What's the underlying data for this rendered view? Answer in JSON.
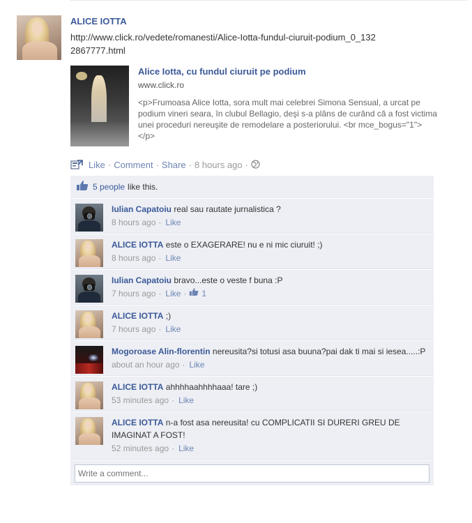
{
  "post": {
    "author": "ALICE IOTTA",
    "link_url": "http://www.click.ro/vedete/romanesti/Alice-Iotta-fundul-ciuruit-podium_0_1322867777.html",
    "attachment": {
      "title": "Alice Iotta, cu fundul ciuruit pe podium",
      "domain": "www.click.ro",
      "description": "<p>Frumoasa Alice Iotta, sora mult mai celebrei Simona Sensual, a urcat pe podium vineri seara, în clubul Bellagio, deşi s-a plâns de curând că a fost victima unei proceduri nereuşite de remodelare a posteriorului. <br mce_bogus=\"1\"></p>"
    },
    "actions": {
      "like": "Like",
      "comment": "Comment",
      "share": "Share",
      "time": "8 hours ago"
    }
  },
  "likes": {
    "people": "5 people",
    "suffix": "like this."
  },
  "comments": [
    {
      "author": "Iulian Capatoiu",
      "text": "real sau rautate jurnalistica ?",
      "time": "8 hours ago",
      "like": "Like",
      "avatar": "camera-man"
    },
    {
      "author": "ALICE IOTTA",
      "text": "este o EXAGERARE! nu e ni mic ciuruit! ;)",
      "time": "8 hours ago",
      "like": "Like",
      "avatar": "blonde"
    },
    {
      "author": "Iulian Capatoiu",
      "text": "bravo...este o veste f buna :P",
      "time": "7 hours ago",
      "like": "Like",
      "like_count": "1",
      "avatar": "camera-man"
    },
    {
      "author": "ALICE IOTTA",
      "text": ";)",
      "time": "7 hours ago",
      "like": "Like",
      "avatar": "blonde"
    },
    {
      "author": "Mogoroase Alin-florentin",
      "text": "nereusita?si totusi asa buuna?pai dak ti mai si iesea.....:P",
      "time": "about an hour ago",
      "like": "Like",
      "avatar": "club"
    },
    {
      "author": "ALICE IOTTA",
      "text": "ahhhhaahhhhaaa! tare ;)",
      "time": "53 minutes ago",
      "like": "Like",
      "avatar": "blonde"
    },
    {
      "author": "ALICE IOTTA",
      "text": "n-a fost asa nereusita! cu COMPLICATII SI DURERI GREU DE IMAGINAT A FOST!",
      "time": "52 minutes ago",
      "like": "Like",
      "avatar": "blonde"
    }
  ],
  "write_comment": {
    "placeholder": "Write a comment..."
  },
  "colors": {
    "link": "#3b5998",
    "feedback_bg": "#edeff4"
  }
}
